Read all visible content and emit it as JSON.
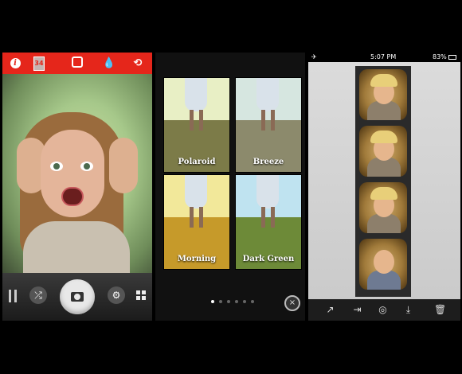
{
  "camera_screen": {
    "top_toolbar": {
      "info_icon": "i",
      "photo_count": "34",
      "frame_icon": "frame-icon",
      "drop_icon": "💧",
      "switch_camera_icon": "⟲"
    },
    "bottom_toolbar": {
      "film_icon": "film-icon",
      "shuffle_icon": "⤮",
      "shutter_icon": "camera-icon",
      "settings_icon": "⚙",
      "grid_icon": "grid-icon"
    },
    "accent_color": "#e5261b"
  },
  "filter_screen": {
    "filters": [
      {
        "label": "Polaroid",
        "sky": "#e8efc5",
        "grass": "#7c7b48"
      },
      {
        "label": "Breeze",
        "sky": "#d6e6e0",
        "grass": "#8c8a6c"
      },
      {
        "label": "Morning",
        "sky": "#f2e89a",
        "grass": "#c69a2a"
      },
      {
        "label": "Dark Green",
        "sky": "#bfe3f0",
        "grass": "#6d8a38"
      }
    ],
    "page_dots": 6,
    "active_dot": 0,
    "close_icon": "×"
  },
  "photo_strip_screen": {
    "status_bar": {
      "airplane_icon": "✈",
      "time": "5:07 PM",
      "battery": "83%"
    },
    "frames": 4,
    "toolbar": {
      "share_icon": "↗",
      "export_icon": "⇥",
      "instagram_icon": "◎",
      "download_icon": "⤓",
      "delete_icon": "🗑"
    }
  }
}
